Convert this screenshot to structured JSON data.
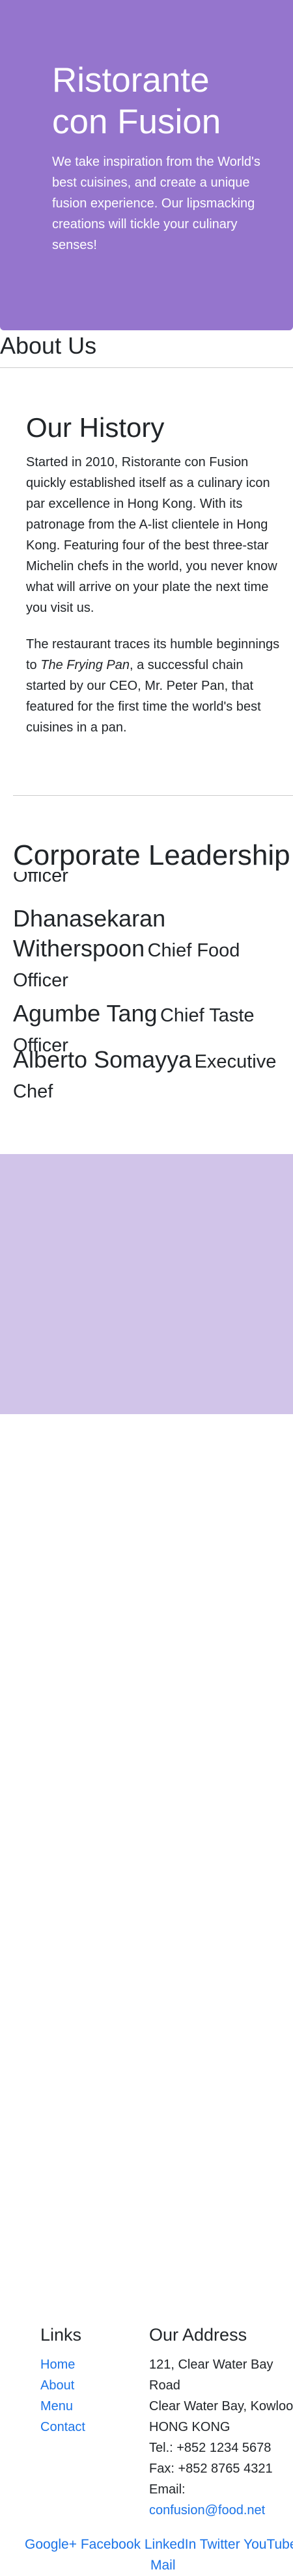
{
  "jumbotron": {
    "title_line1": "Ristorante",
    "title_line2": "con Fusion",
    "tagline": "We take inspiration from the World's best cuisines, and create a unique fusion experience. Our lipsmacking creations will tickle your culinary senses!"
  },
  "about": {
    "title": "About Us",
    "history_title": "Our History",
    "p1_lines": [
      "Started in 2010, Ristorante con Fusion",
      "quickly established itself as a culinary icon",
      "par excellence in Hong Kong. With its",
      "patronage from the A-list clientele in Hong",
      "Kong. Featuring four of the best three-star",
      "Michelin chefs in the world, you never know",
      "what will arrive on your plate the next time",
      "you visit us."
    ],
    "p2_line1": "The restaurant traces its humble beginnings",
    "p2_line2_pre": "to ",
    "p2_line2_em": "The Frying Pan",
    "p2_line2_post": ", a successful chain",
    "p2_line3": "started by our CEO, Mr. Peter Pan, that",
    "p2_line4": "featured for the first time the world's best",
    "p2_line5": "cuisines in a pan."
  },
  "leadership": {
    "title": "Corporate Leadership",
    "overlap_fragment": "Officer",
    "leaders": [
      {
        "name_line1": "Dhanasekaran",
        "name_line2": "Witherspoon",
        "designation_a": "Chief Food",
        "designation_b": "Officer"
      },
      {
        "name": "Agumbe Tang",
        "designation_a": "Chief Taste",
        "designation_b": "Officer"
      },
      {
        "name": "Alberto Somayya",
        "designation_a": "Executive",
        "designation_b": "Chef"
      }
    ]
  },
  "footer": {
    "links_title": "Links",
    "links": [
      "Home",
      "About",
      "Menu",
      "Contact"
    ],
    "address_title": "Our Address",
    "address_lines": [
      "121, Clear Water Bay",
      "Road",
      "Clear Water Bay, Kowloon",
      "HONG KONG",
      "Tel.: +852 1234 5678",
      "Fax: +852 8765 4321",
      "Email:"
    ],
    "email": "confusion@food.net",
    "social_line1": "Google+ Facebook LinkedIn Twitter YouTube",
    "social_line2": "Mail"
  },
  "colors": {
    "jumbotron_bg": "#9575cd",
    "footer_bg": "#d1c4e9",
    "link": "#1a73e8"
  }
}
